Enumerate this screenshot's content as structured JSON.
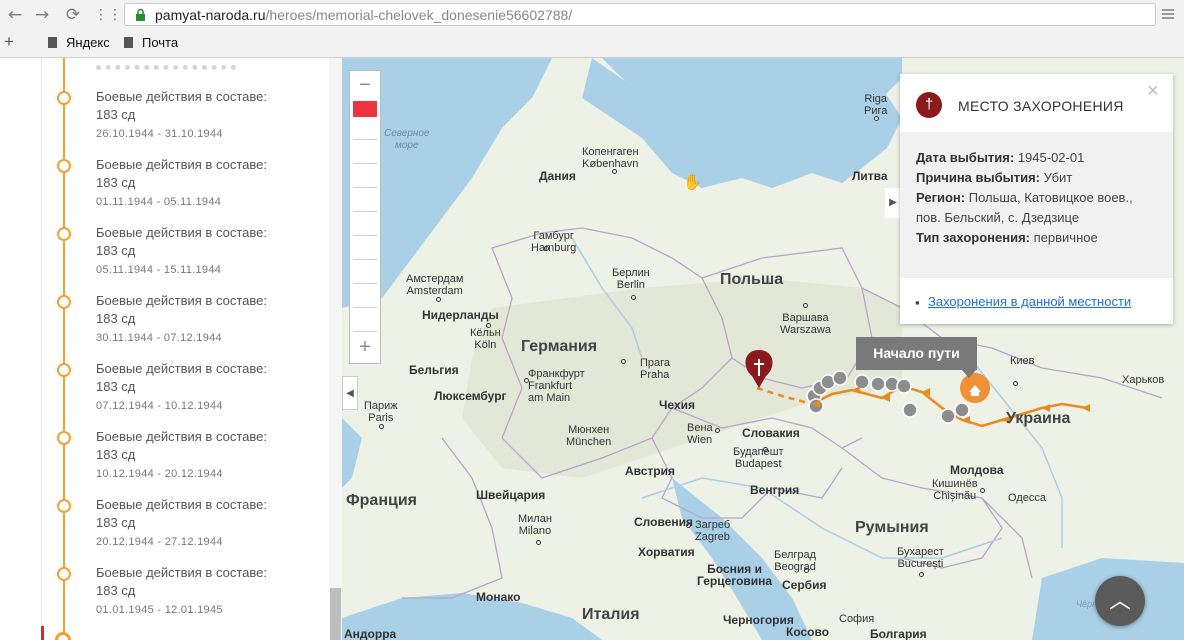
{
  "browser": {
    "back_icon": "back-arrow-icon",
    "forward_icon": "forward-arrow-icon",
    "reload_icon": "reload-icon",
    "apps_icon": "apps-grid-icon",
    "url_host": "pamyat-naroda.ru",
    "url_path": "/heroes/memorial-chelovek_donesenie56602788/",
    "bookmarks": [
      {
        "label": "Яндекс"
      },
      {
        "label": "Почта"
      }
    ]
  },
  "timeline": {
    "items": [
      {
        "title": "Боевые действия в составе:",
        "division": "183 сд",
        "dates": "26.10.1944 - 31.10.1944"
      },
      {
        "title": "Боевые действия в составе:",
        "division": "183 сд",
        "dates": "01.11.1944 - 05.11.1944"
      },
      {
        "title": "Боевые действия в составе:",
        "division": "183 сд",
        "dates": "05.11.1944 - 15.11.1944"
      },
      {
        "title": "Боевые действия в составе:",
        "division": "183 сд",
        "dates": "30.11.1944 - 07.12.1944"
      },
      {
        "title": "Боевые действия в составе:",
        "division": "183 сд",
        "dates": "07.12.1944 - 10.12.1944"
      },
      {
        "title": "Боевые действия в составе:",
        "division": "183 сд",
        "dates": "10.12.1944 - 20.12.1944"
      },
      {
        "title": "Боевые действия в составе:",
        "division": "183 сд",
        "dates": "20.12.1944 - 27.12.1944"
      },
      {
        "title": "Боевые действия в составе:",
        "division": "183 сд",
        "dates": "01.01.1945 - 12.01.1945"
      }
    ]
  },
  "map": {
    "zoom_in": "−",
    "zoom_out": "+",
    "start_tooltip": "Начало пути",
    "attribution": "Чёрное море",
    "labels": {
      "sea_north": "Северное\nморе",
      "riga": "Riga\nРига",
      "copenhagen": "Копенгаген\nKøbenhavn",
      "denmark": "Дания",
      "lithuania": "Литва",
      "hamburg": "Гамбург\nHamburg",
      "berlin": "Берлин\nBerlin",
      "poland": "Польша",
      "warsaw": "Варшава\nWarszawa",
      "amsterdam": "Амстердам\nAmsterdam",
      "netherlands": "Нидерланды",
      "cologne": "Кёльн\nKöln",
      "germany": "Германия",
      "belgium": "Бельгия",
      "frankfurt": "Франкфурт\nFrankfurt\nam Main",
      "prague": "Прага\nPraha",
      "luxembourg": "Люксембург",
      "paris": "Париж\nParis",
      "czechia": "Чехия",
      "vienna": "Вена\nWien",
      "slovakia": "Словакия",
      "munich": "Мюнхен\nMünchen",
      "budapest": "Будапешт\nBudapest",
      "austria": "Австрия",
      "hungary": "Венгрия",
      "switzerland": "Швейцария",
      "france": "Франция",
      "milan": "Милан\nMilano",
      "slovenia": "Словения",
      "zagreb": "Загреб\nZagreb",
      "croatia": "Хорватия",
      "bosnia": "Босния и\nГерцеговина",
      "belgrade": "Белград\nBeograd",
      "serbia": "Сербия",
      "romania": "Румыния",
      "bucharest": "Бухарест\nBucurești",
      "moldova": "Молдова",
      "chisinau": "Кишинёв\nChișinău",
      "odessa": "Одесса",
      "kyiv": "Киев",
      "kharkiv": "Харьков",
      "ukraine": "Украина",
      "monaco": "Монако",
      "italy": "Италия",
      "montenegro": "Черногория",
      "kosovo": "Косово",
      "sofia": "София",
      "bulgaria": "Болгария",
      "andorra": "Андорра"
    }
  },
  "info_panel": {
    "icon": "cross-icon",
    "title": "МЕСТО ЗАХОРОНЕНИЯ",
    "close": "×",
    "fields": [
      {
        "label": "Дата выбытия:",
        "value": "1945-02-01"
      },
      {
        "label": "Причина выбытия:",
        "value": "Убит"
      },
      {
        "label": "Регион:",
        "value": "Польша, Катовицкое воев., пов. Бельский, с. Дзедзице"
      },
      {
        "label": "Тип захоронения:",
        "value": "первичное"
      }
    ],
    "link": "Захоронения в данной местности"
  },
  "colors": {
    "accent": "#f0a030",
    "burial": "#8b1a1f",
    "zoom_marker": "#ef3340"
  }
}
